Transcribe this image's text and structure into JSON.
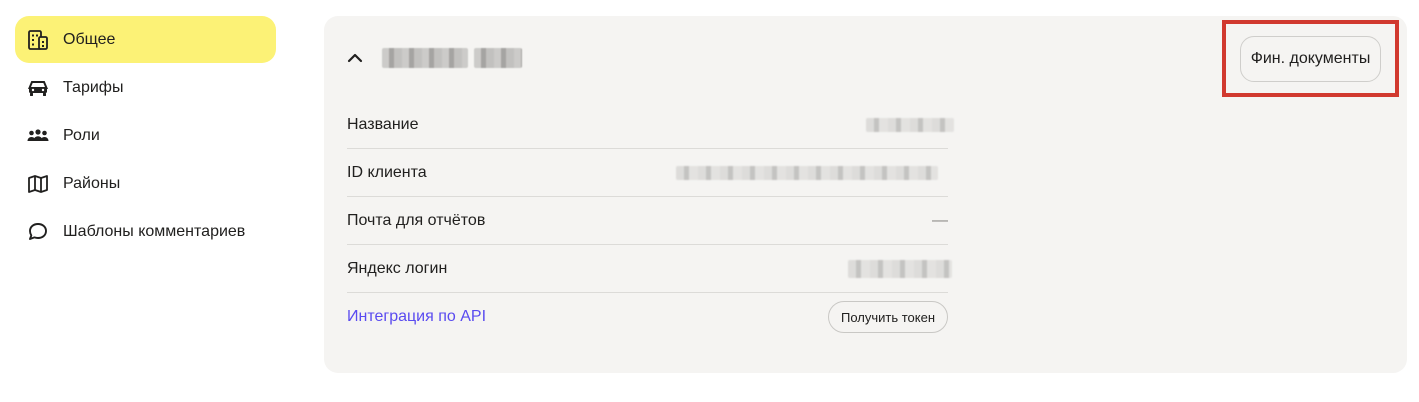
{
  "sidebar": {
    "items": [
      {
        "label": "Общее",
        "icon": "building-icon",
        "active": true
      },
      {
        "label": "Тарифы",
        "icon": "car-icon",
        "active": false
      },
      {
        "label": "Роли",
        "icon": "users-icon",
        "active": false
      },
      {
        "label": "Районы",
        "icon": "map-icon",
        "active": false
      },
      {
        "label": "Шаблоны комментариев",
        "icon": "comment-icon",
        "active": false
      }
    ]
  },
  "card": {
    "fin_docs_label": "Фин. документы",
    "rows": {
      "name_label": "Название",
      "client_id_label": "ID клиента",
      "email_label": "Почта для отчётов",
      "email_value": "—",
      "login_label": "Яндекс логин",
      "api_label": "Интеграция по API",
      "token_button": "Получить токен"
    }
  },
  "colors": {
    "active_bg": "#fcf276",
    "card_bg": "#f5f4f2",
    "link": "#5a4bf0",
    "highlight_border": "#d1392f"
  }
}
